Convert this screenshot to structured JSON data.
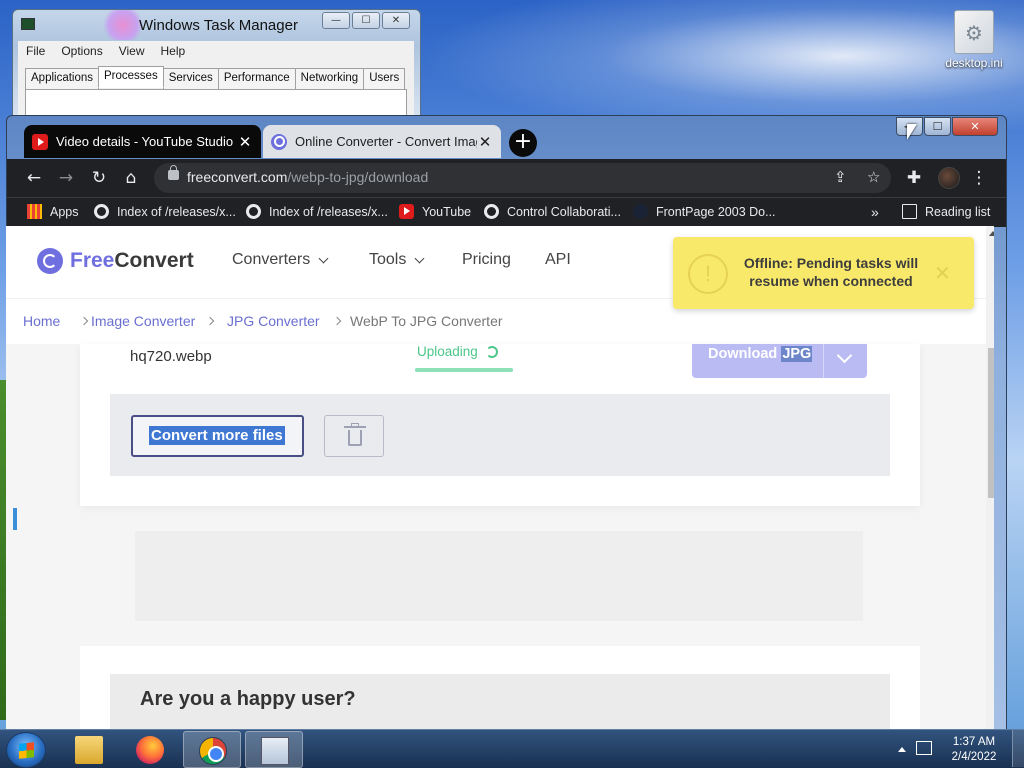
{
  "desktop": {
    "icon_label": "desktop.ini"
  },
  "task_manager": {
    "title": "Windows Task Manager",
    "menu": [
      "File",
      "Options",
      "View",
      "Help"
    ],
    "tabs": [
      "Applications",
      "Processes",
      "Services",
      "Performance",
      "Networking",
      "Users"
    ],
    "active_tab": "Processes"
  },
  "browser": {
    "tabs": [
      {
        "title": "Video details - YouTube Studio",
        "favicon": "youtube-icon",
        "active": true
      },
      {
        "title": "Online Converter - Convert Imag",
        "favicon": "freeconvert-icon",
        "active": false
      }
    ],
    "new_tab": "+",
    "address": {
      "host": "freeconvert.com",
      "path": "/webp-to-jpg/download"
    },
    "bookmarks": [
      {
        "label": "Apps",
        "icon": "apps-grid-icon"
      },
      {
        "label": "Index of /releases/x...",
        "icon": "github-icon"
      },
      {
        "label": "Index of /releases/x...",
        "icon": "github-icon"
      },
      {
        "label": "YouTube",
        "icon": "youtube-icon"
      },
      {
        "label": "Control Collaborati...",
        "icon": "github-icon"
      },
      {
        "label": "FrontPage 2003 Do...",
        "icon": "frontpage-icon"
      }
    ],
    "overflow": "»",
    "reading_list": "Reading list"
  },
  "site": {
    "logo": {
      "free": "Free",
      "convert": "Convert"
    },
    "nav": [
      "Converters",
      "Tools",
      "Pricing",
      "API"
    ],
    "breadcrumbs": [
      "Home",
      "Image Converter",
      "JPG Converter",
      "WebP To JPG Converter"
    ],
    "toast": {
      "icon": "!",
      "message": "Offline: Pending tasks will resume when connected",
      "close": "✕"
    },
    "file": {
      "name": "hq720.webp",
      "status": "Uploading",
      "progress": 1.0,
      "download_label_a": "Download ",
      "download_label_b": "JPG"
    },
    "convert_more": "Convert more files",
    "happy_heading": "Are you a happy user?"
  },
  "taskbar": {
    "time": "1:37 AM",
    "date": "2/4/2022"
  }
}
